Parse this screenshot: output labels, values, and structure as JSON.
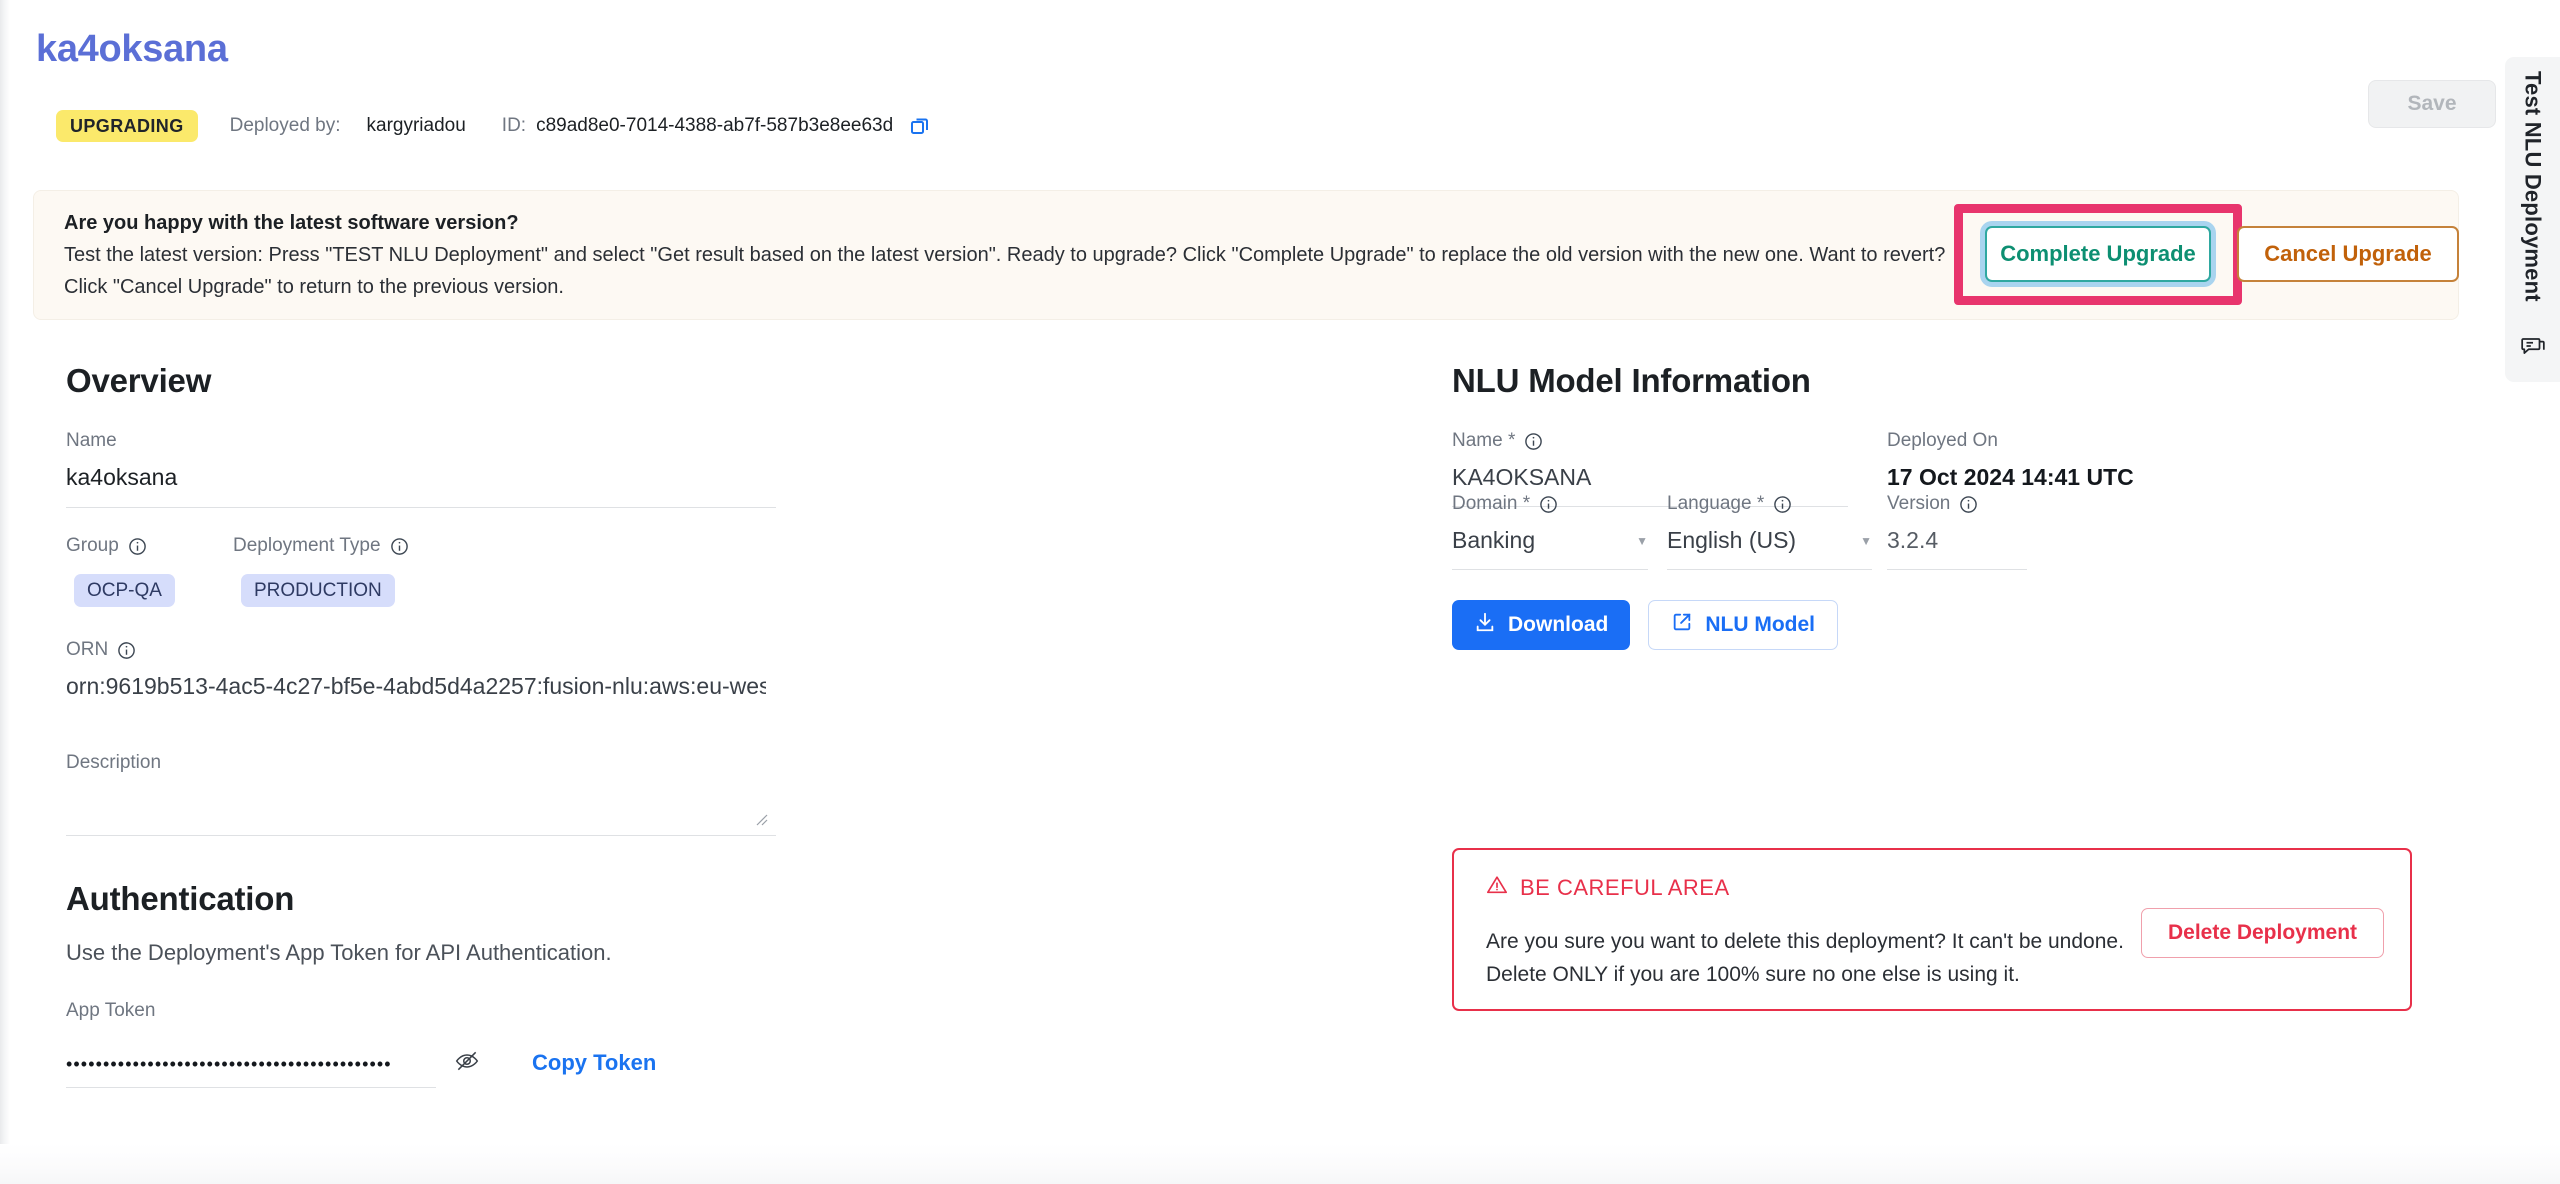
{
  "header": {
    "title": "ka4oksana",
    "status_badge": "UPGRADING",
    "deployed_by_label": "Deployed by:",
    "deployed_by_value": "kargyriadou",
    "id_label": "ID:",
    "id_value": "c89ad8e0-7014-4388-ab7f-587b3e8ee63d",
    "save_label": "Save"
  },
  "banner": {
    "line1": "Are you happy with the latest software version?",
    "line2": "Test the latest version: Press \"TEST NLU Deployment\" and select \"Get result based on the latest version\". Ready to upgrade? Click \"Complete Upgrade\" to replace the old version with the new one. Want to revert?",
    "line3": "Click \"Cancel Upgrade\" to return to the previous version.",
    "complete_label": "Complete Upgrade",
    "cancel_label": "Cancel Upgrade",
    "highlight_color": "#e8356d",
    "complete_text_color": "#0d8f72",
    "cancel_text_color": "#c1610a",
    "background": "#fdf9f3"
  },
  "overview": {
    "heading": "Overview",
    "name_label": "Name",
    "name_value": "ka4oksana",
    "group_label": "Group",
    "group_value": "OCP-QA",
    "deployment_type_label": "Deployment Type",
    "deployment_type_value": "PRODUCTION",
    "orn_label": "ORN",
    "orn_value": "orn:9619b513-4ac5-4c27-bf5e-4abd5d4a2257:fusion-nlu:aws:eu-wes",
    "description_label": "Description",
    "description_value": ""
  },
  "authentication": {
    "heading": "Authentication",
    "subtitle": "Use the Deployment's App Token for API Authentication.",
    "token_label": "App Token",
    "token_masked": "••••••••••••••••••••••••••••••••••••••••••••",
    "copy_token_label": "Copy Token"
  },
  "nlu": {
    "heading": "NLU Model Information",
    "name_label": "Name *",
    "name_value": "KA4OKSANA",
    "deployed_on_label": "Deployed On",
    "deployed_on_value": "17 Oct 2024 14:41 UTC",
    "domain_label": "Domain *",
    "domain_value": "Banking",
    "language_label": "Language *",
    "language_value": "English (US)",
    "version_label": "Version",
    "version_value": "3.2.4",
    "download_label": "Download",
    "nlu_model_label": "NLU Model"
  },
  "danger": {
    "title": "BE CAREFUL AREA",
    "text": "Are you sure you want to delete this deployment? It can't be undone. Delete ONLY if you are 100% sure no one else is using it.",
    "delete_label": "Delete Deployment",
    "accent": "#e8304a"
  },
  "side_tab": {
    "label": "Test NLU Deployment"
  }
}
